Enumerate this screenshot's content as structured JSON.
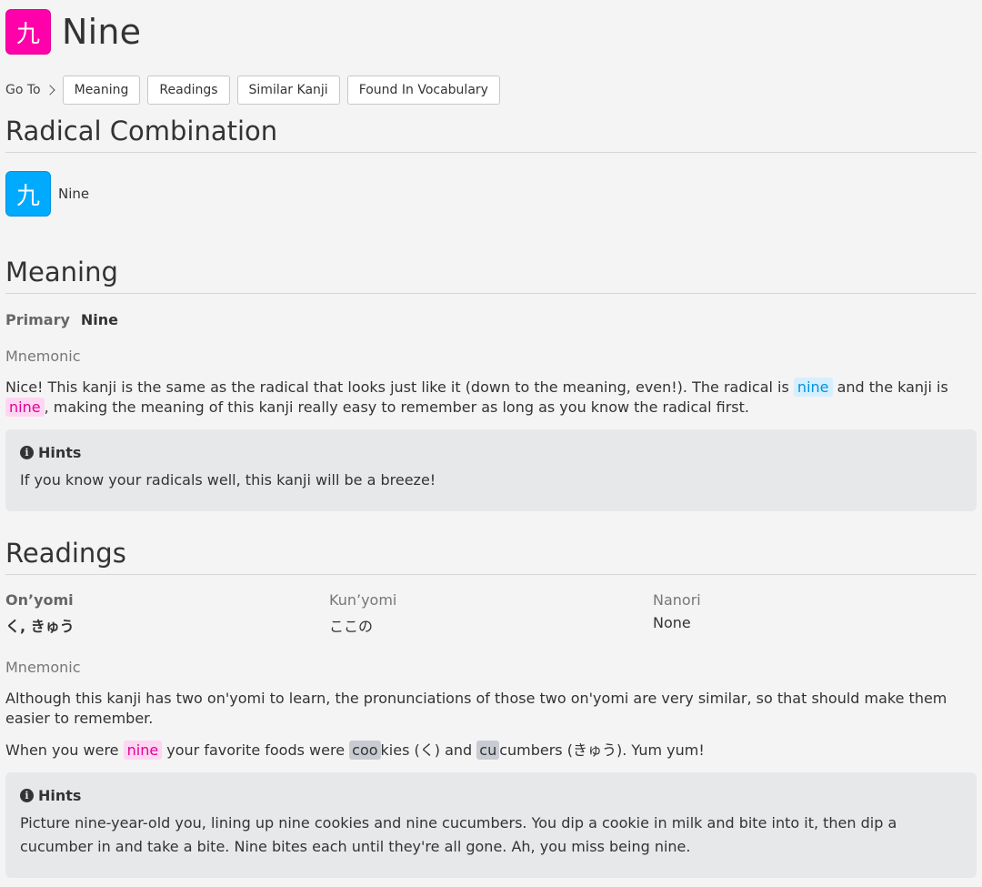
{
  "header": {
    "kanji": "九",
    "title": "Nine"
  },
  "goto": {
    "label": "Go To",
    "buttons": [
      "Meaning",
      "Readings",
      "Similar Kanji",
      "Found In Vocabulary"
    ]
  },
  "radical_combination": {
    "heading": "Radical Combination",
    "radical_char": "九",
    "radical_name": "Nine"
  },
  "meaning": {
    "heading": "Meaning",
    "primary_label": "Primary",
    "primary_value": "Nine",
    "mnemonic_label": "Mnemonic",
    "mnemonic_part1": "Nice! This kanji is the same as the radical that looks just like it (down to the meaning, even!). The radical is ",
    "mnemonic_radical": "nine",
    "mnemonic_part2": " and the kanji is ",
    "mnemonic_kanji": "nine",
    "mnemonic_part3": ", making the meaning of this kanji really easy to remember as long as you know the radical first.",
    "hints_title": "Hints",
    "hints_text": "If you know your radicals well, this kanji will be a breeze!"
  },
  "readings": {
    "heading": "Readings",
    "onyomi_label": "On’yomi",
    "onyomi_value": "く, きゅう",
    "kunyomi_label": "Kun’yomi",
    "kunyomi_value": "ここの",
    "nanori_label": "Nanori",
    "nanori_value": "None",
    "mnemonic_label": "Mnemonic",
    "mnemonic_p1": "Although this kanji has two on'yomi to learn, the pronunciations of those two on'yomi are very similar, so that should make them easier to remember.",
    "p2_a": "When you were ",
    "p2_kanji": "nine",
    "p2_b": " your favorite foods were ",
    "p2_r1": "coo",
    "p2_c": "kies (く) and ",
    "p2_r2": "cu",
    "p2_d": "cumbers (きゅう). Yum yum!",
    "hints_title": "Hints",
    "hints_text": "Picture nine-year-old you, lining up nine cookies and nine cucumbers. You dip a cookie in milk and bite into it, then dip a cucumber in and take a bite. Nine bites each until they're all gone. Ah, you miss being nine."
  },
  "colors": {
    "kanji": "#ff00aa",
    "radical": "#00aaff",
    "background": "#f4f4f4",
    "hint_box": "#e7e8ea"
  },
  "icons": {
    "chevron": "chevron-right-icon",
    "info": "info-icon"
  }
}
